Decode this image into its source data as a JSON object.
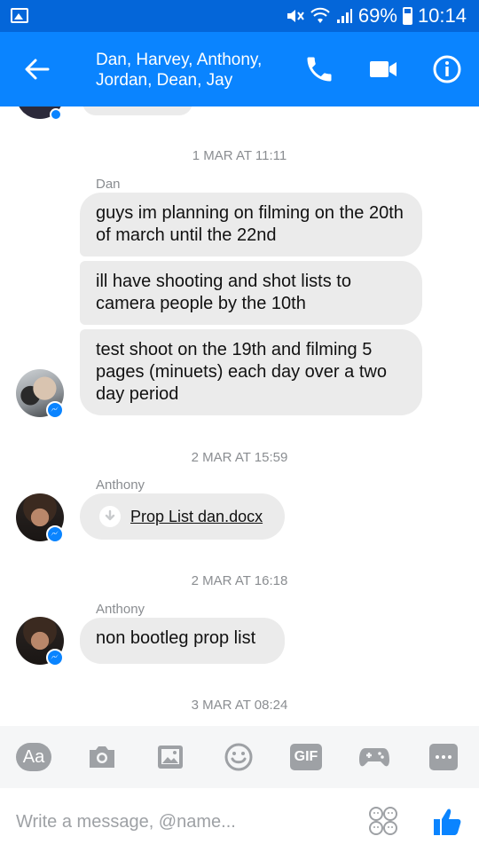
{
  "status_bar": {
    "battery": "69%",
    "time": "10:14"
  },
  "header": {
    "title_line1": "Dan, Harvey, Anthony,",
    "title_line2": "Jordan, Dean, Jay"
  },
  "conversation": {
    "groups": [
      {
        "timestamp": "1 MAR AT 11:11",
        "sender": "Dan",
        "messages": [
          "guys im planning on filming on the 20th of march until the 22nd",
          "ill have shooting and shot lists to camera people by the 10th",
          "test shoot on the 19th and filming 5 pages (minuets) each day over a two day period"
        ]
      },
      {
        "timestamp": "2 MAR AT 15:59",
        "sender": "Anthony",
        "attachment": "Prop List dan.docx"
      },
      {
        "timestamp": "2 MAR AT 16:18",
        "sender": "Anthony",
        "messages": [
          "non bootleg prop list"
        ]
      },
      {
        "timestamp": "3 MAR AT 08:24"
      }
    ]
  },
  "composer": {
    "aa_label": "Aa",
    "gif_label": "GIF",
    "placeholder": "Write a message, @name..."
  },
  "colors": {
    "status_bar": "#0466d9",
    "header": "#0a84ff",
    "bubble": "#ebebeb",
    "accent": "#0a84ff"
  }
}
